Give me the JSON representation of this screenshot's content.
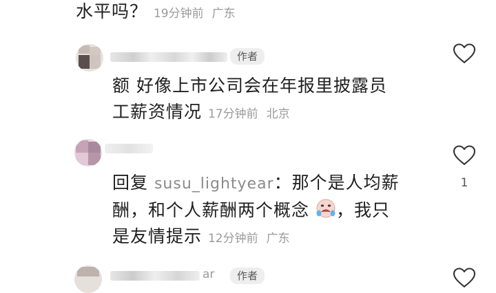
{
  "comments": [
    {
      "text": "水平吗？",
      "time": "19分钟前",
      "location": "广东"
    },
    {
      "author_tag": "作者",
      "line1": "额 好像上市公司会在年报里披露员",
      "line2": "工薪资情况",
      "time": "17分钟前",
      "location": "北京"
    },
    {
      "reply_prefix": "回复",
      "reply_to": "susu_lightyear",
      "reply_colon": "：",
      "line1": "那个是人均薪",
      "line2a": "酬，和个人薪酬两个概念",
      "line2b": "，我只",
      "line3": "是友情提示",
      "time": "12分钟前",
      "location": "广东",
      "likes": "1"
    },
    {
      "author_tag": "作者",
      "name_partial": "ar"
    }
  ],
  "icons": {
    "like": "heart-outline-icon",
    "emoji": "crying-face-emoji-icon"
  },
  "colors": {
    "text": "#1f1f1f",
    "meta": "#9a9a9a",
    "tag_bg": "#eeeeee"
  }
}
